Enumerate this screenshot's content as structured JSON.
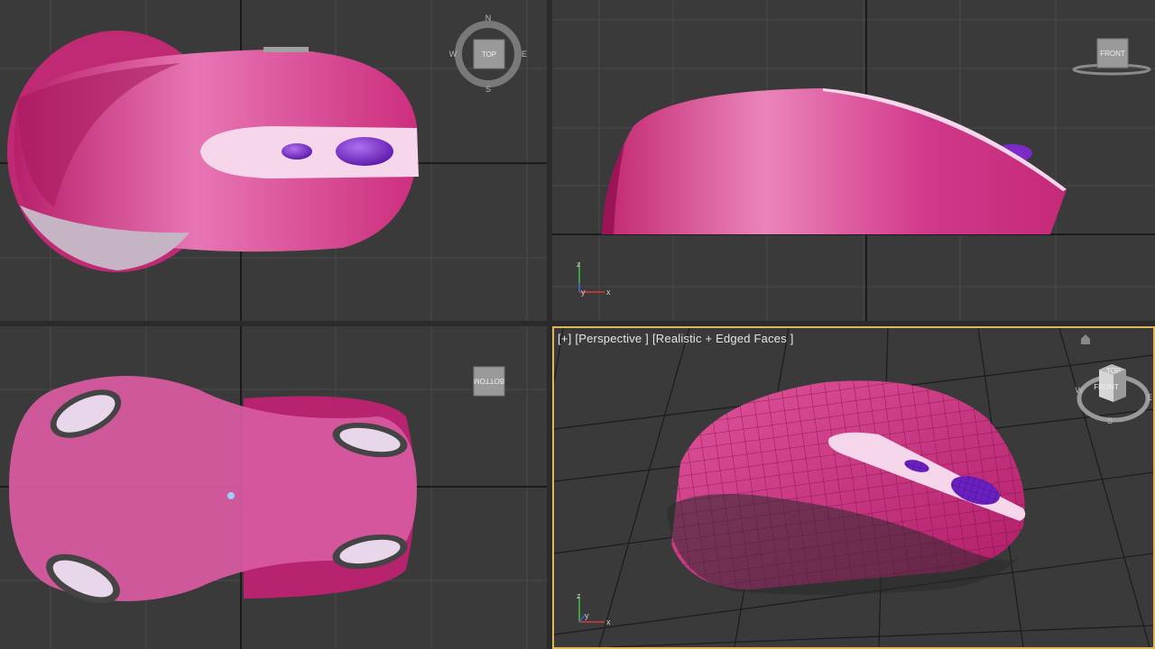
{
  "viewports": {
    "top": {
      "cube_label": "TOP",
      "compass": {
        "n": "N",
        "s": "S",
        "e": "E",
        "w": "W"
      }
    },
    "front": {
      "cube_label": "FRONT",
      "axes": {
        "x": "x",
        "y": "y",
        "z": "z"
      }
    },
    "bottom": {
      "cube_label": "BOTTOM"
    },
    "perspective": {
      "label_plus": "[+]",
      "label_view": "[Perspective ]",
      "label_shading": "[Realistic + Edged Faces ]",
      "cube_top": "TOP",
      "cube_front": "FRONT",
      "compass": {
        "w": "W",
        "e": "E",
        "s": "S"
      },
      "axes": {
        "x": "x",
        "y": "y",
        "z": "z"
      }
    }
  },
  "colors": {
    "background": "#3a3a3a",
    "grid": "#4a4a4a",
    "grid_major": "#111111",
    "model_pink": "#d93f8c",
    "button_light": "#f6d6ea",
    "wheel_purple": "#7a2bc8",
    "active_border": "#e0b85a"
  }
}
